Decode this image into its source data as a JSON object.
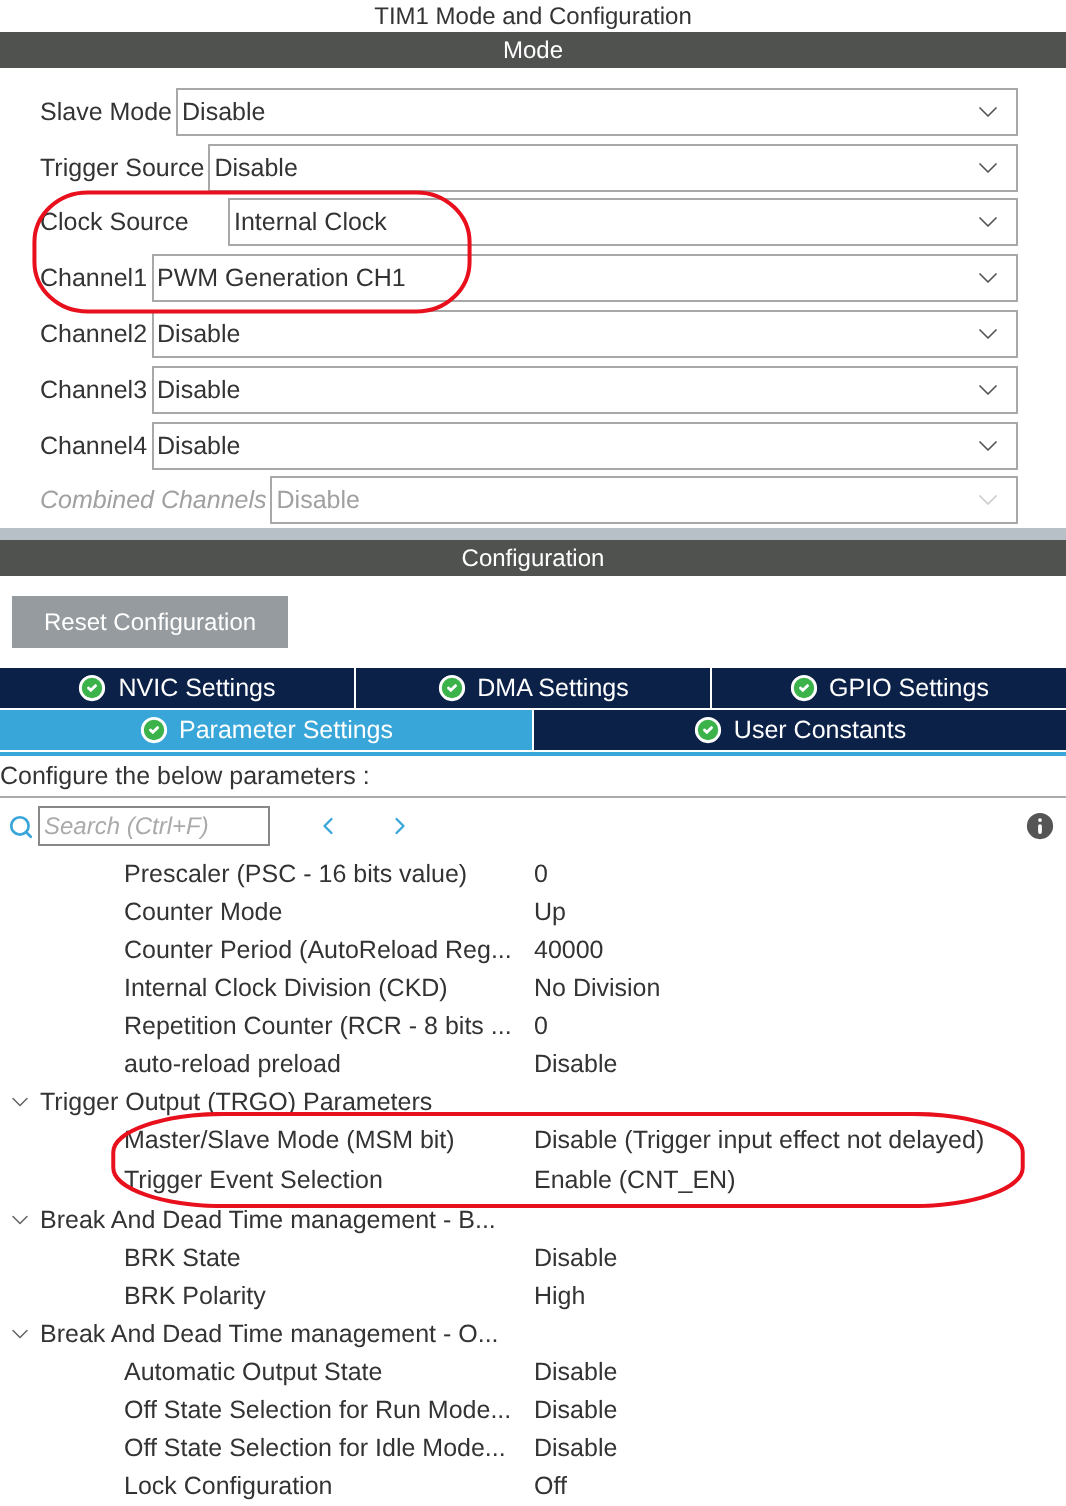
{
  "title": "TIM1 Mode and Configuration",
  "mode": {
    "header": "Mode",
    "fields": [
      {
        "label": "Slave Mode",
        "value": "Disable",
        "disabled": false,
        "circled": false
      },
      {
        "label": "Trigger Source",
        "value": "Disable",
        "disabled": false,
        "circled": false
      },
      {
        "label": "Clock Source",
        "value": "Internal Clock",
        "disabled": false,
        "circled": true
      },
      {
        "label": "Channel1",
        "value": "PWM Generation CH1",
        "disabled": false,
        "circled": true
      },
      {
        "label": "Channel2",
        "value": "Disable",
        "disabled": false,
        "circled": false
      },
      {
        "label": "Channel3",
        "value": "Disable",
        "disabled": false,
        "circled": false
      },
      {
        "label": "Channel4",
        "value": "Disable",
        "disabled": false,
        "circled": false
      },
      {
        "label": "Combined Channels",
        "value": "Disable",
        "disabled": true,
        "circled": false
      }
    ]
  },
  "configuration": {
    "header": "Configuration",
    "reset_button": "Reset Configuration",
    "tab_rows": [
      [
        {
          "label": "NVIC Settings",
          "selected": false
        },
        {
          "label": "DMA Settings",
          "selected": false
        },
        {
          "label": "GPIO Settings",
          "selected": false
        }
      ],
      [
        {
          "label": "Parameter Settings",
          "selected": true
        },
        {
          "label": "User Constants",
          "selected": false
        }
      ]
    ],
    "instructions": "Configure the below parameters :",
    "search": {
      "placeholder": "Search (Ctrl+F)"
    },
    "tree": [
      {
        "children": [
          {
            "label": "Prescaler (PSC - 16 bits value)",
            "value": "0",
            "circled": false
          },
          {
            "label": "Counter Mode",
            "value": "Up",
            "circled": false
          },
          {
            "label": "Counter Period (AutoReload Reg...",
            "value": "40000",
            "circled": false
          },
          {
            "label": "Internal Clock Division (CKD)",
            "value": "No Division",
            "circled": false
          },
          {
            "label": "Repetition Counter (RCR - 8 bits ...",
            "value": "0",
            "circled": false
          },
          {
            "label": "auto-reload preload",
            "value": "Disable",
            "circled": false
          }
        ]
      },
      {
        "label": "Trigger Output (TRGO) Parameters",
        "expanded": true,
        "children": [
          {
            "label": "Master/Slave Mode (MSM bit)",
            "value": "Disable (Trigger input effect not delayed)",
            "circled": true
          },
          {
            "label": "Trigger Event Selection",
            "value": "Enable (CNT_EN)",
            "circled": true
          }
        ]
      },
      {
        "label": "Break And Dead Time management - B...",
        "expanded": true,
        "children": [
          {
            "label": "BRK State",
            "value": "Disable",
            "circled": false
          },
          {
            "label": "BRK Polarity",
            "value": "High",
            "circled": false
          }
        ]
      },
      {
        "label": "Break And Dead Time management - O...",
        "expanded": true,
        "children": [
          {
            "label": "Automatic Output State",
            "value": "Disable",
            "circled": false
          },
          {
            "label": "Off State Selection for Run Mode...",
            "value": "Disable",
            "circled": false
          },
          {
            "label": "Off State Selection for Idle Mode...",
            "value": "Disable",
            "circled": false
          },
          {
            "label": "Lock Configuration",
            "value": "Off",
            "circled": false
          }
        ]
      }
    ]
  }
}
